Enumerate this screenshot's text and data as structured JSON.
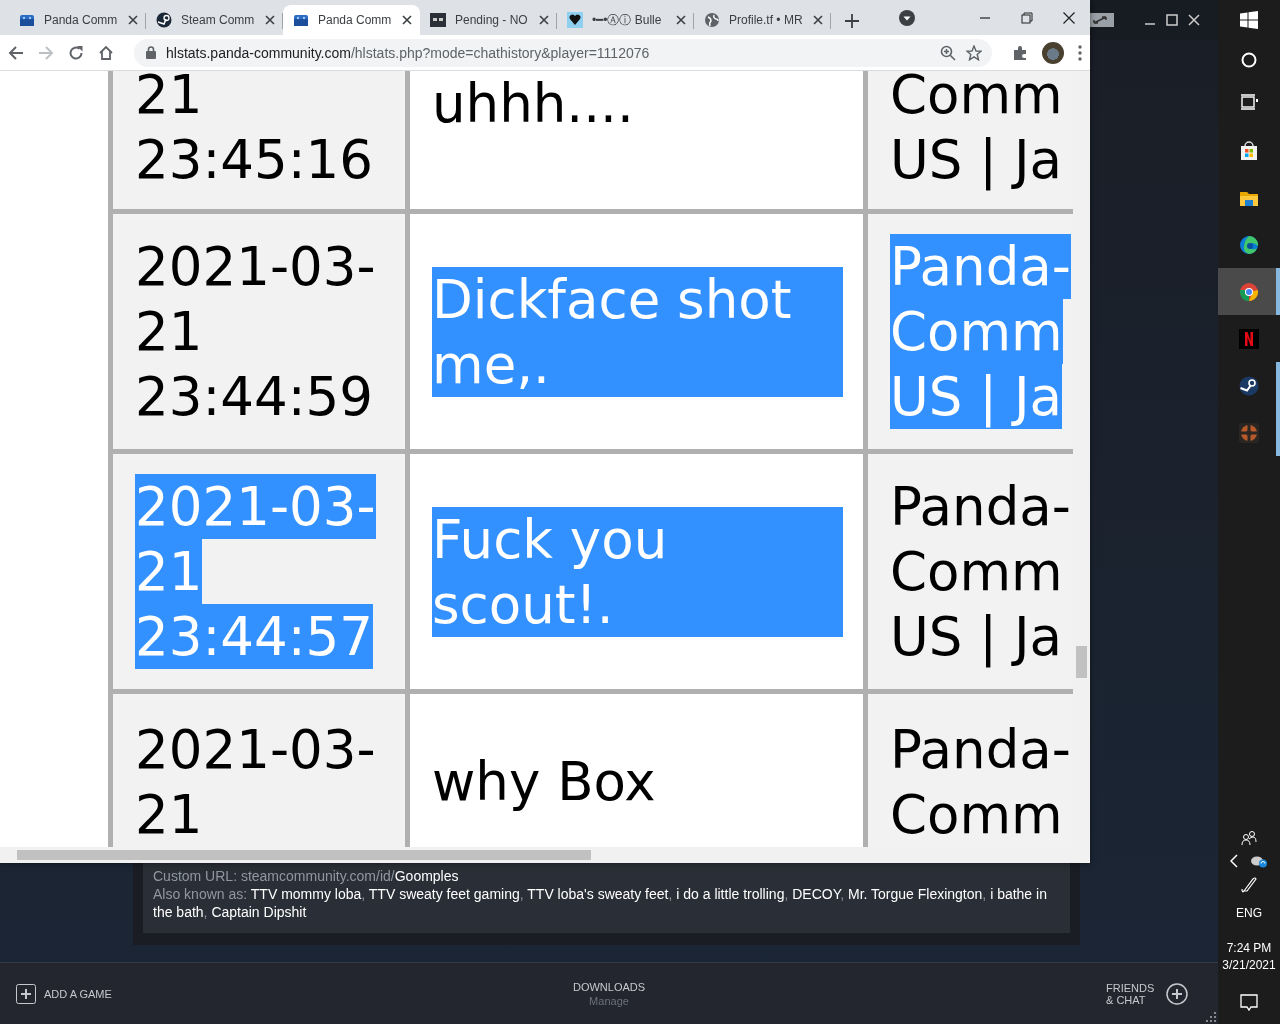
{
  "browser": {
    "tabs": [
      {
        "title": "Panda Comm",
        "kind": "panda",
        "selected": false
      },
      {
        "title": "Steam Comm",
        "kind": "steam",
        "selected": false
      },
      {
        "title": "Panda Comm",
        "kind": "panda",
        "selected": true
      },
      {
        "title": "Pending - NO",
        "kind": "dark",
        "selected": false
      },
      {
        "title": "•━•Ⓐⓘ Bulle",
        "kind": "heart",
        "selected": false
      },
      {
        "title": "Profile.tf • MR",
        "kind": "globe",
        "selected": false
      }
    ],
    "address": {
      "host": "hlstats.panda-community.com",
      "path": "/hlstats.php?mode=chathistory&player=1112076"
    }
  },
  "chat_table": {
    "rows": [
      {
        "date": {
          "lines": [
            "21",
            "23:45:16"
          ],
          "selected": false
        },
        "message": {
          "text": "uhhh....",
          "selected": false
        },
        "server": {
          "lines": [
            "Comm",
            "US | Ja"
          ],
          "selected": false
        }
      },
      {
        "date": {
          "lines": [
            "2021-03-",
            "21",
            "23:44:59"
          ],
          "selected": false
        },
        "message": {
          "text": "Dickface shot me,.",
          "selected": true
        },
        "server": {
          "lines": [
            "Panda-",
            "Comm",
            "US | Ja"
          ],
          "selected": true
        }
      },
      {
        "date": {
          "lines": [
            "2021-03-",
            "21",
            "23:44:57"
          ],
          "selected": true
        },
        "message": {
          "text": "Fuck you scout!.",
          "selected": true
        },
        "server": {
          "lines": [
            "Panda-",
            "Comm",
            "US | Ja"
          ],
          "selected": false
        }
      },
      {
        "date": {
          "lines": [
            "2021-03-",
            "21"
          ],
          "selected": false
        },
        "message": {
          "text": "why Box",
          "selected": false
        },
        "server": {
          "lines": [
            "Panda-",
            "Comm"
          ],
          "selected": false
        }
      }
    ]
  },
  "steam": {
    "custom_url": {
      "label": "Custom URL:",
      "prefix": "steamcommunity.com/id/",
      "id": "Goomples"
    },
    "also_known_as": {
      "label": "Also known as:",
      "separator": ", ",
      "names": [
        "TTV mommy loba",
        "TTV sweaty feet gaming",
        "TTV loba's sweaty feet",
        "i do a little trolling",
        "DECOY",
        "Mr. Torgue Flexington",
        "i bathe in the bath",
        "Captain Dipshit"
      ]
    },
    "bottom_bar": {
      "add_game": "ADD A GAME",
      "downloads": "DOWNLOADS",
      "downloads_sub": "Manage",
      "friends": "FRIENDS & CHAT"
    }
  },
  "taskbar": {
    "apps": [
      {
        "kind": "task-view",
        "selected": false,
        "running": false
      },
      {
        "kind": "store",
        "selected": false,
        "running": false
      },
      {
        "kind": "folder",
        "selected": false,
        "running": false
      },
      {
        "kind": "edge",
        "selected": false,
        "running": false
      },
      {
        "kind": "chrome",
        "selected": true,
        "running": true
      },
      {
        "kind": "netflix",
        "selected": false,
        "running": false
      },
      {
        "kind": "steam",
        "selected": false,
        "running": true
      },
      {
        "kind": "game",
        "selected": false,
        "running": true
      }
    ],
    "language": "ENG",
    "time": "7:24 PM",
    "date": "3/21/2021"
  }
}
